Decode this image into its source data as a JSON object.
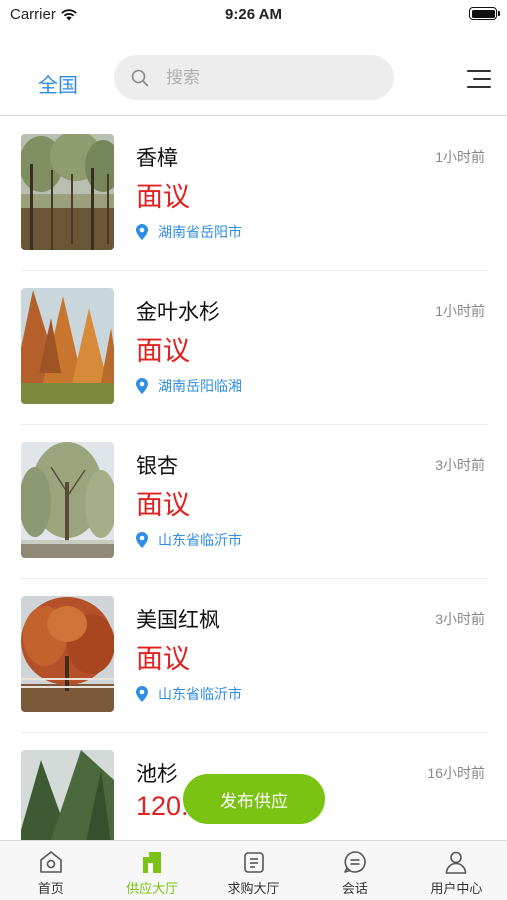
{
  "status": {
    "carrier": "Carrier",
    "time": "9:26 AM"
  },
  "header": {
    "region": "全国",
    "search_placeholder": "搜索"
  },
  "items": [
    {
      "name": "香樟",
      "price": "面议",
      "location": "湖南省岳阳市",
      "time": "1小时前"
    },
    {
      "name": "金叶水杉",
      "price": "面议",
      "location": "湖南岳阳临湘",
      "time": "1小时前"
    },
    {
      "name": "银杏",
      "price": "面议",
      "location": "山东省临沂市",
      "time": "3小时前"
    },
    {
      "name": "美国红枫",
      "price": "面议",
      "location": "山东省临沂市",
      "time": "3小时前"
    },
    {
      "name": "池杉",
      "price": "120.",
      "location": "",
      "time": "16小时前"
    }
  ],
  "fab": {
    "label": "发布供应"
  },
  "tabs": [
    {
      "label": "首页",
      "icon": "home-icon"
    },
    {
      "label": "供应大厅",
      "icon": "supply-icon"
    },
    {
      "label": "求购大厅",
      "icon": "purchase-icon"
    },
    {
      "label": "会话",
      "icon": "chat-icon"
    },
    {
      "label": "用户中心",
      "icon": "user-icon"
    }
  ],
  "colors": {
    "accent_blue": "#2f8de4",
    "price_red": "#e0211f",
    "brand_green": "#7ac312"
  }
}
